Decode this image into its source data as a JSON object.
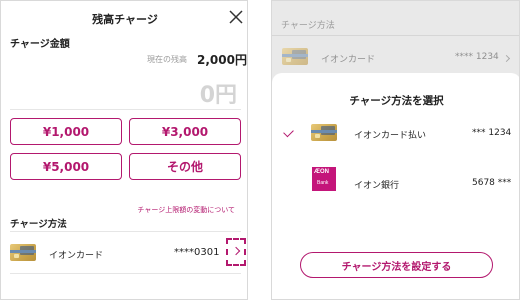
{
  "left": {
    "title": "残高チャージ",
    "amount_label": "チャージ金額",
    "current_balance_label": "現在の残高",
    "current_balance_value": "2,000円",
    "input_amount": "0円",
    "amount_buttons": [
      "¥1,000",
      "¥3,000",
      "¥5,000",
      "その他"
    ],
    "limit_link": "チャージ上限額の変動について",
    "method_label": "チャージ方法",
    "selected_card": {
      "name": "イオンカード",
      "number": "****0301"
    }
  },
  "right": {
    "background_label": "チャージ方法",
    "background_card": {
      "name": "イオンカード",
      "number": "**** 1234"
    },
    "sheet_title": "チャージ方法を選択",
    "options": [
      {
        "name": "イオンカード払い",
        "number": "*** 1234",
        "selected": true
      },
      {
        "name": "イオン銀行",
        "number": "5678 ***",
        "selected": false
      }
    ],
    "bank_logo_text": "ÆON",
    "bank_logo_subtext": "Bank",
    "set_button": "チャージ方法を設定する"
  },
  "colors": {
    "accent": "#b3186e",
    "bank_brand": "#c4157a"
  },
  "icons": [
    "close-icon",
    "chevron-right-icon",
    "check-icon"
  ]
}
